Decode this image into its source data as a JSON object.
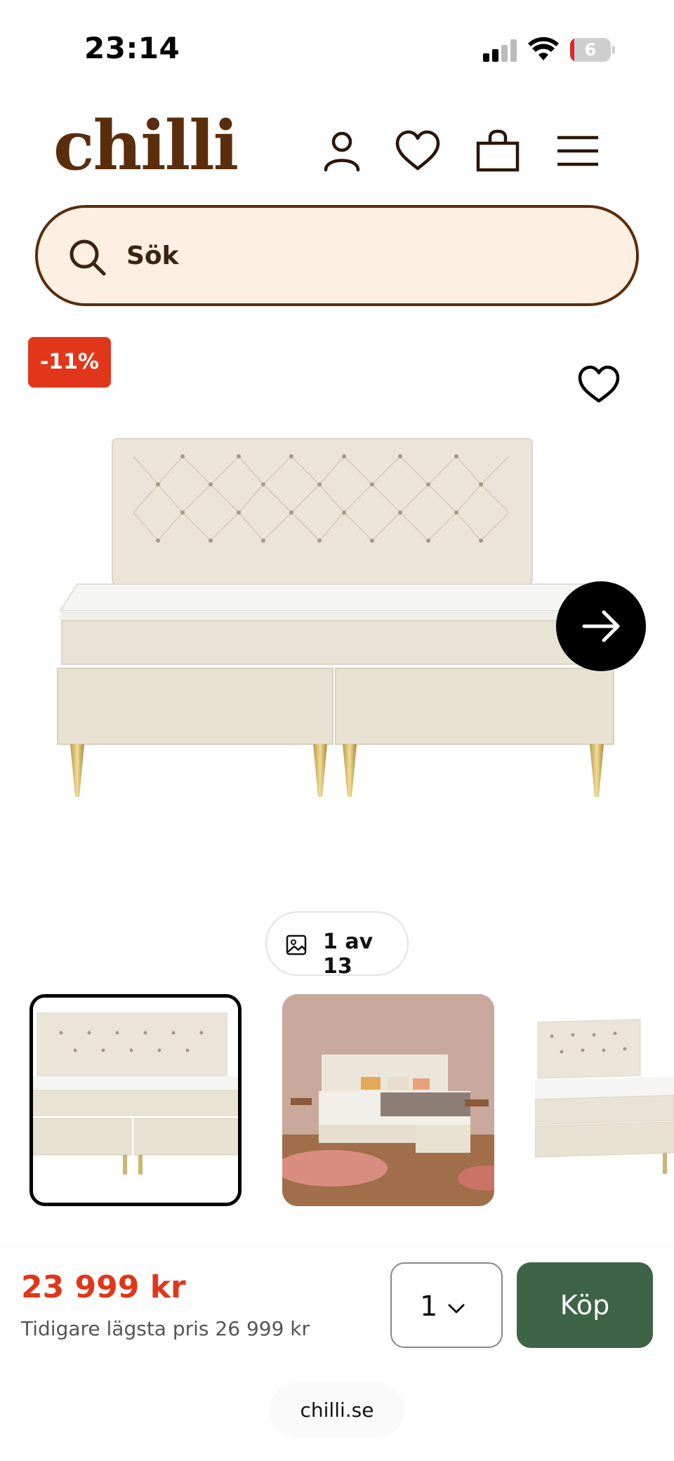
{
  "status_bar": {
    "time": "23:14",
    "battery": "6"
  },
  "header": {
    "logo": "chilli",
    "icons": [
      "user-icon",
      "heart-icon",
      "bag-icon",
      "menu-icon"
    ]
  },
  "search": {
    "placeholder": "Sök"
  },
  "product": {
    "discount_badge": "-11%",
    "image_counter": "1 av 13",
    "price": "23 999 kr",
    "previous_price": "Tidigare lägsta pris 26 999 kr",
    "quantity": "1",
    "buy_label": "Köp"
  },
  "browser": {
    "url": "chilli.se"
  },
  "colors": {
    "brand_brown": "#5a2d0c",
    "search_bg": "#fdf0e2",
    "sale_red": "#e2361a",
    "buy_green": "#3d6447"
  }
}
